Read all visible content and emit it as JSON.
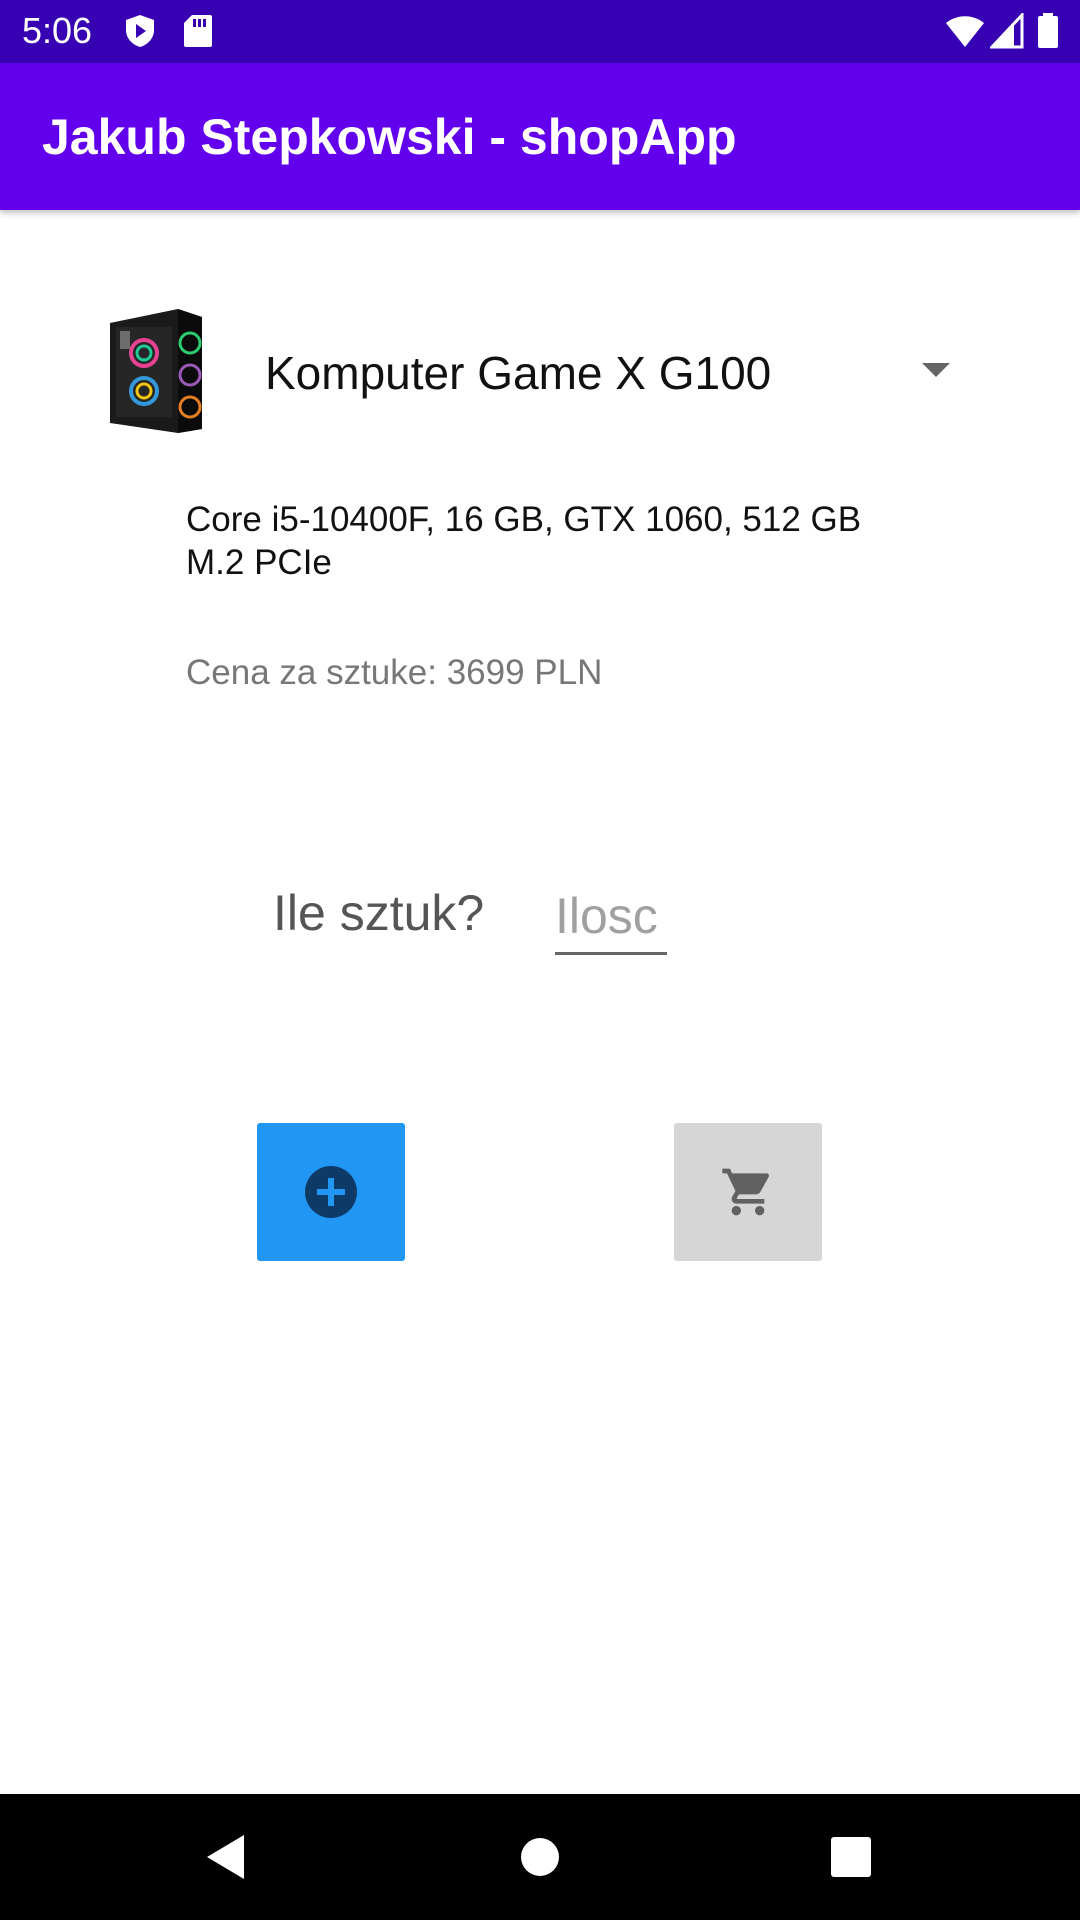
{
  "status_bar": {
    "time": "5:06",
    "icons": [
      "shield-play-icon",
      "sd-card-icon",
      "wifi-icon",
      "signal-icon",
      "battery-icon"
    ]
  },
  "app_bar": {
    "title": "Jakub Stepkowski - shopApp"
  },
  "product": {
    "name": "Komputer Game X G100",
    "description": "Core i5-10400F, 16 GB, GTX 1060, 512 GB M.2 PCIe",
    "price_text": "Cena za sztuke: 3699 PLN",
    "image_icon": "pc-case-image"
  },
  "quantity": {
    "label": "Ile sztuk?",
    "placeholder": "Ilosc",
    "value": ""
  },
  "actions": {
    "add_icon": "plus-circle-icon",
    "cart_icon": "cart-icon"
  },
  "colors": {
    "status_bar": "#3700b3",
    "app_bar": "#6200ee",
    "add_button": "#2196f3",
    "cart_button": "#d6d6d6"
  },
  "nav_bar": {
    "icons": [
      "back-icon",
      "home-icon",
      "recents-icon"
    ]
  }
}
